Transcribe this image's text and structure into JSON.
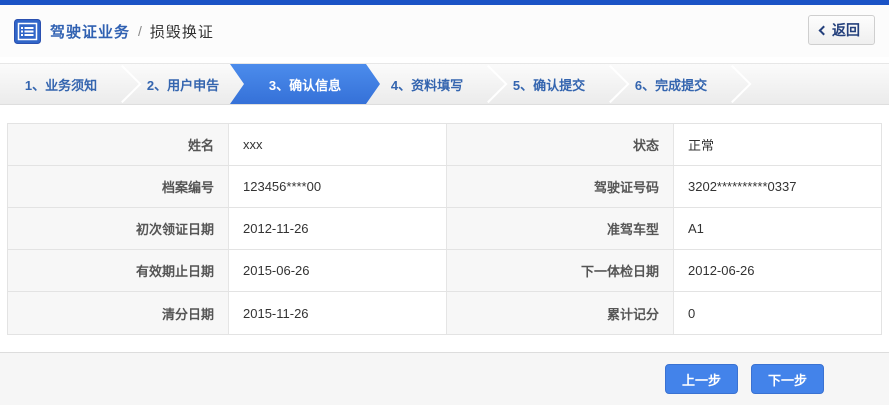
{
  "colors": {
    "topbar_blue": "#1b53c6",
    "active_step_blue": "#3d7ee4",
    "button_blue": "#4383ea",
    "title_blue": "#3061b2",
    "label_bg": "#f7f7f7"
  },
  "icons": {
    "header": "license-list-icon",
    "back": "chevron-left-icon",
    "step_separator": "chevron-right-icon"
  },
  "header": {
    "title": "驾驶证业务",
    "breadcrumb_separator": "/",
    "subtitle": "损毁换证",
    "back_button": "返回"
  },
  "wizard": {
    "active_step_index": 2,
    "steps": [
      {
        "label": "1、业务须知",
        "active": false
      },
      {
        "label": "2、用户申告",
        "active": false
      },
      {
        "label": "3、确认信息",
        "active": true
      },
      {
        "label": "4、资料填写",
        "active": false
      },
      {
        "label": "5、确认提交",
        "active": false
      },
      {
        "label": "6、完成提交",
        "active": false
      }
    ]
  },
  "form": {
    "rows": [
      {
        "left_label": "姓名",
        "left_value": "xxx",
        "right_label": "状态",
        "right_value": "正常"
      },
      {
        "left_label": "档案编号",
        "left_value": "123456****00",
        "right_label": "驾驶证号码",
        "right_value": "3202**********0337"
      },
      {
        "left_label": "初次领证日期",
        "left_value": "2012-11-26",
        "right_label": "准驾车型",
        "right_value": "A1"
      },
      {
        "left_label": "有效期止日期",
        "left_value": "2015-06-26",
        "right_label": "下一体检日期",
        "right_value": "2012-06-26"
      },
      {
        "left_label": "清分日期",
        "left_value": "2015-11-26",
        "right_label": "累计记分",
        "right_value": "0"
      }
    ]
  },
  "footer": {
    "prev_button": "上一步",
    "next_button": "下一步"
  }
}
